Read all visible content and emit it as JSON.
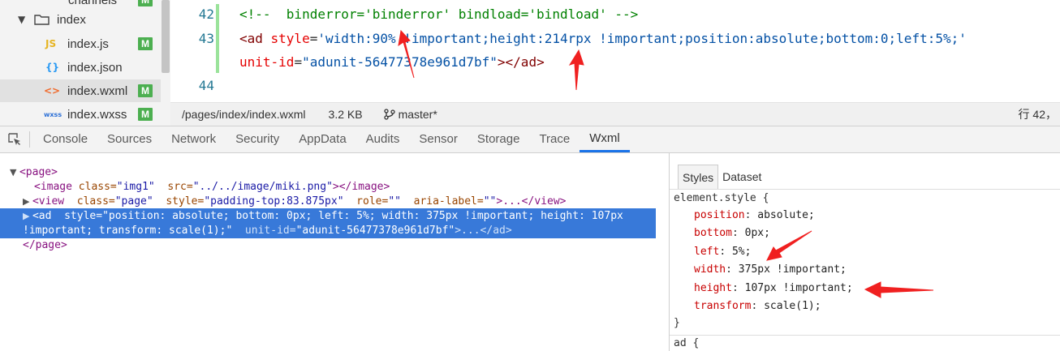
{
  "file_tree": {
    "top_item": "channels",
    "folder": "index",
    "files": [
      {
        "name": "index.js",
        "icon": "JS",
        "badge": "M"
      },
      {
        "name": "index.json",
        "icon": "{}",
        "badge": ""
      },
      {
        "name": "index.wxml",
        "icon": "<>",
        "badge": "M"
      },
      {
        "name": "index.wxss",
        "icon": "wxss",
        "badge": "M"
      }
    ]
  },
  "editor": {
    "line_42_no": "42",
    "line_42_code": "<!--  binderror='binderror' bindload='bindload' -->",
    "line_43_no": "43",
    "line_43_a": "<ad ",
    "line_43_b": "style",
    "line_43_c": "=",
    "line_43_d": "'width:90% !important;height:214rpx !important;position:absolute;bottom:0;left:5%;'",
    "line_43_e": "unit-id",
    "line_43_f": "=",
    "line_43_g": "\"adunit-56477378e961d7bf\"",
    "line_43_h": "></ad>",
    "line_44_no": "44"
  },
  "status_bar": {
    "path": "/pages/index/index.wxml",
    "size": "3.2 KB",
    "branch": "master*",
    "position": "行 42，"
  },
  "devtools_tabs": [
    "Console",
    "Sources",
    "Network",
    "Security",
    "AppData",
    "Audits",
    "Sensor",
    "Storage",
    "Trace",
    "Wxml"
  ],
  "active_tab": "Wxml",
  "elements": {
    "page_open": "<page>",
    "image_line": {
      "tag": "<image",
      "a1": " class=",
      "v1": "\"img1\"",
      "a2": "  src=",
      "v2": "\"../../image/miki.png\"",
      "close": "></image>"
    },
    "view_line": {
      "tag": "<view",
      "a1": "  class=",
      "v1": "\"page\"",
      "a2": "  style=",
      "v2": "\"padding-top:83.875px\"",
      "a3": "  role=",
      "v3": "\"\"",
      "a4": "  aria-label=",
      "v4": "\"\"",
      "close": ">...</view>"
    },
    "ad_line1": {
      "tag": "<ad",
      "a1": "  style=",
      "v1": "\"position: absolute; bottom: 0px; left: 5%; width: 375px !important; height: 107px"
    },
    "ad_line2": {
      "v1": "!important; transform: scale(1);\"",
      "a2": "  unit-id=",
      "v2": "\"adunit-56477378e961d7bf\"",
      "close": ">...</ad>"
    },
    "page_close": "</page>"
  },
  "styles": {
    "tabs": [
      "Styles",
      "Dataset"
    ],
    "selector": "element.style {",
    "rules": [
      {
        "prop": "position",
        "value": "absolute;"
      },
      {
        "prop": "bottom",
        "value": "0px;"
      },
      {
        "prop": "left",
        "value": "5%;"
      },
      {
        "prop": "width",
        "value": "375px !important;"
      },
      {
        "prop": "height",
        "value": "107px !important;"
      },
      {
        "prop": "transform",
        "value": "scale(1);"
      }
    ],
    "close": "}",
    "next_selector": "ad {"
  },
  "colors": {
    "accent": "#1a73e8",
    "selection": "#3879d9",
    "badge": "#4caf50",
    "annotation_arrow": "#f02020"
  }
}
